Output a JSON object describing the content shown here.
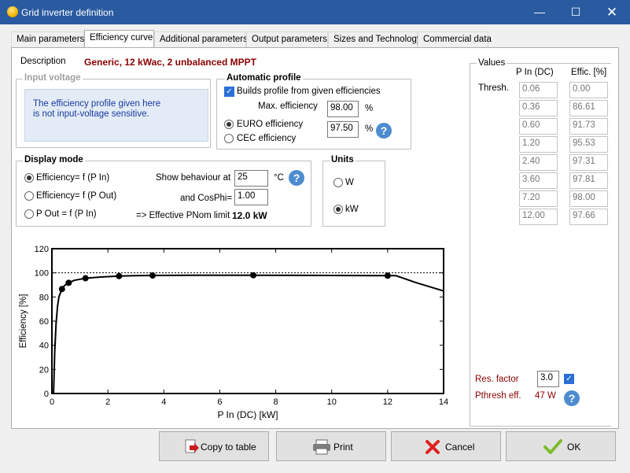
{
  "window": {
    "title": "Grid inverter definition"
  },
  "tabs": [
    "Main parameters",
    "Efficiency curve",
    "Additional parameters",
    "Output parameters",
    "Sizes and Technology",
    "Commercial data"
  ],
  "description": {
    "label": "Description",
    "value": "Generic, 12 kWac, 2 unbalanced MPPT"
  },
  "input_voltage": {
    "title": "Input voltage",
    "message_line1": "The efficiency profile given here",
    "message_line2": "is not input-voltage sensitive."
  },
  "auto_profile": {
    "title": "Automatic profile",
    "builds_label": "Builds profile from given efficiencies",
    "builds_checked": true,
    "max_eff_label": "Max. efficiency",
    "max_eff_value": "98.00",
    "pct1": "%",
    "euro_label": "EURO efficiency",
    "euro_value": "97.50",
    "pct2": "%",
    "cec_label": "CEC efficiency",
    "selected": "euro"
  },
  "display_mode": {
    "title": "Display mode",
    "options": [
      "Efficiency= f (P In)",
      "Efficiency= f (P Out)",
      "P Out = f (P In)"
    ],
    "selected": 0,
    "show_label": "Show behaviour at",
    "temp_value": "25",
    "temp_unit": "°C",
    "cosphi_label": "and CosPhi=",
    "cosphi_value": "1.00",
    "pnom_label": "=> Effective PNom limit",
    "pnom_value": "12.0 kW"
  },
  "units": {
    "title": "Units",
    "options": [
      "W",
      "kW"
    ],
    "selected": "kW"
  },
  "values": {
    "title": "Values",
    "col1": "P In (DC)",
    "col2": "Effic. [%]",
    "thresh_label": "Thresh.",
    "rows": [
      [
        "0.06",
        "0.00"
      ],
      [
        "0.36",
        "86.61"
      ],
      [
        "0.60",
        "91.73"
      ],
      [
        "1.20",
        "95.53"
      ],
      [
        "2.40",
        "97.31"
      ],
      [
        "3.60",
        "97.81"
      ],
      [
        "7.20",
        "98.00"
      ],
      [
        "12.00",
        "97.66"
      ]
    ],
    "res_factor_label": "Res. factor",
    "res_factor_value": "3.0",
    "res_checked": true,
    "pthresh_label": "Pthresh eff.",
    "pthresh_value": "47 W"
  },
  "chart_data": {
    "type": "line",
    "xlabel": "P In (DC) [kW]",
    "ylabel": "Efficiency [%]",
    "xlim": [
      0,
      14
    ],
    "ylim": [
      0,
      120
    ],
    "xticks": [
      "0",
      "2",
      "4",
      "6",
      "8",
      "10",
      "12",
      "14"
    ],
    "yticks": [
      "0",
      "20",
      "40",
      "60",
      "80",
      "100",
      "120"
    ],
    "reference_line_y": 100,
    "curve": {
      "x": [
        0.06,
        0.1,
        0.15,
        0.2,
        0.25,
        0.36,
        0.45,
        0.6,
        0.8,
        1.2,
        1.8,
        2.4,
        3.0,
        3.6,
        5.0,
        7.2,
        9.0,
        12.0,
        12.3,
        13.0,
        14.0
      ],
      "y": [
        0.0,
        35,
        58,
        72,
        80,
        86.61,
        89.5,
        91.73,
        93.8,
        95.53,
        96.6,
        97.31,
        97.6,
        97.81,
        97.95,
        98.0,
        97.9,
        97.66,
        97.6,
        92,
        85
      ]
    },
    "points": {
      "x": [
        0.36,
        0.6,
        1.2,
        2.4,
        3.6,
        7.2,
        12.0
      ],
      "y": [
        86.61,
        91.73,
        95.53,
        97.31,
        97.81,
        98.0,
        97.66
      ]
    }
  },
  "buttons": {
    "copy": "Copy to table",
    "print": "Print",
    "cancel": "Cancel",
    "ok": "OK"
  }
}
